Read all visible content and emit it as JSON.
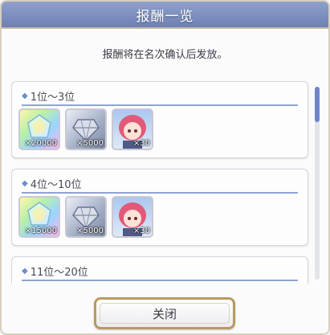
{
  "dialog": {
    "title": "报酬一览",
    "notice": "报酬将在名次确认后发放。",
    "close_label": "关闭"
  },
  "tiers": [
    {
      "label": "1位～3位",
      "items": [
        {
          "icon": "rainbow-jewel-icon",
          "qty": "×20000"
        },
        {
          "icon": "diamond-icon",
          "qty": "×5000"
        },
        {
          "icon": "character-portrait-icon",
          "qty": "×30"
        }
      ]
    },
    {
      "label": "4位～10位",
      "items": [
        {
          "icon": "rainbow-jewel-icon",
          "qty": "×15000"
        },
        {
          "icon": "diamond-icon",
          "qty": "×5000"
        },
        {
          "icon": "character-portrait-icon",
          "qty": "×30"
        }
      ]
    },
    {
      "label": "11位～20位",
      "items": []
    }
  ],
  "colors": {
    "title_bar": "#7f91c0",
    "accent": "#8fa3d6",
    "button_border": "#b89a62"
  }
}
